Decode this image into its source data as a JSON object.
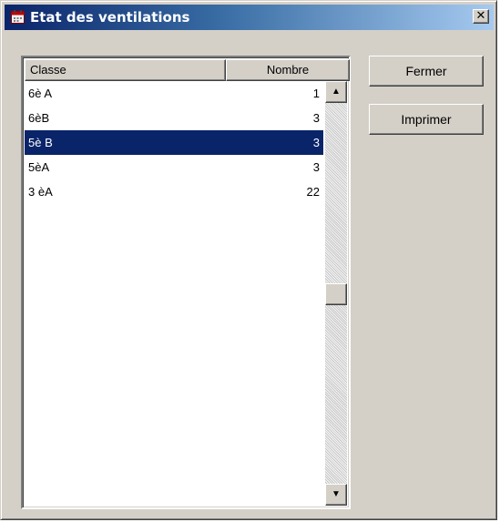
{
  "window": {
    "title": "Etat des ventilations",
    "close_label": "✕"
  },
  "list": {
    "headers": {
      "classe": "Classe",
      "nombre": "Nombre"
    },
    "rows": [
      {
        "classe": "6è A",
        "nombre": "1",
        "selected": false
      },
      {
        "classe": "6èB",
        "nombre": "3",
        "selected": false
      },
      {
        "classe": "5è B",
        "nombre": "3",
        "selected": true
      },
      {
        "classe": "5èA",
        "nombre": "3",
        "selected": false
      },
      {
        "classe": "3 èA",
        "nombre": "22",
        "selected": false
      }
    ]
  },
  "buttons": {
    "fermer": "Fermer",
    "imprimer": "Imprimer"
  },
  "icons": {
    "title": "window-app-icon",
    "scroll_up": "▲",
    "scroll_down": "▼"
  },
  "colors": {
    "selection": "#0a246a",
    "titlebar_start": "#0a246a",
    "face": "#d4d0c8"
  }
}
